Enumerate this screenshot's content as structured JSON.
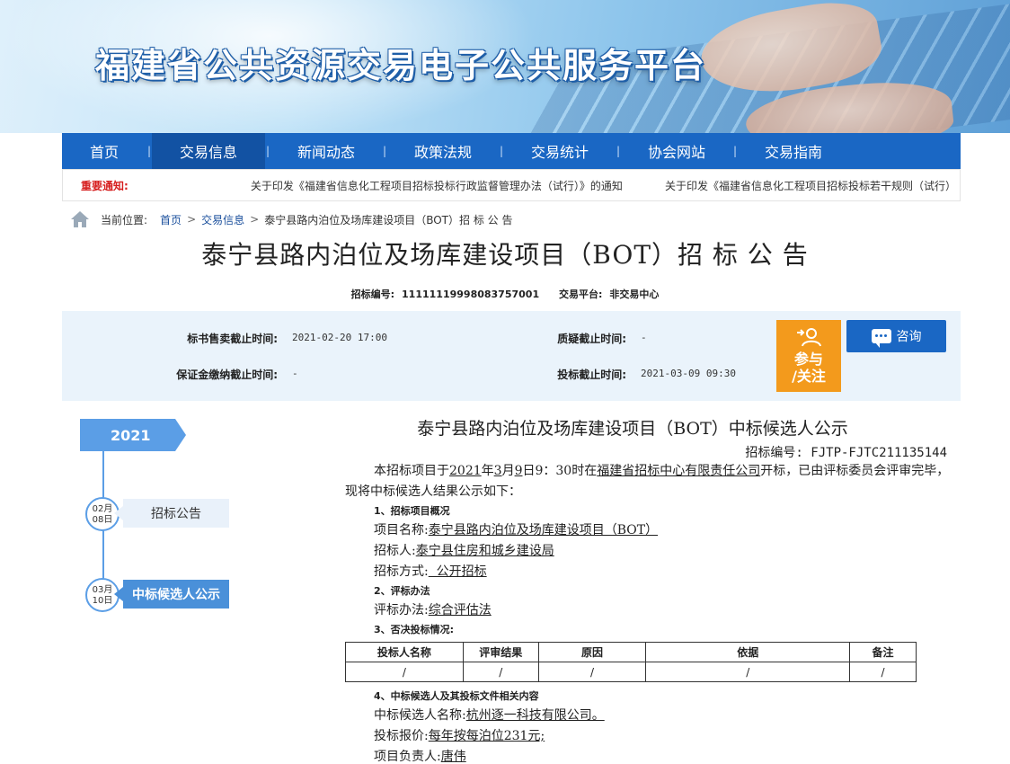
{
  "banner": {
    "title": "福建省公共资源交易电子公共服务平台"
  },
  "nav": {
    "items": [
      "首页",
      "交易信息",
      "新闻动态",
      "政策法规",
      "交易统计",
      "协会网站",
      "交易指南"
    ],
    "separator": "|"
  },
  "notice": {
    "label": "重要通知:",
    "items": [
      "关于印发《福建省信息化工程项目招标投标行政监督管理办法（试行）》的通知",
      "关于印发《福建省信息化工程项目招标投标若干规则（试行）"
    ]
  },
  "breadcrumb": {
    "prefix": "当前位置:",
    "items": [
      "首页",
      "交易信息",
      "泰宁县路内泊位及场库建设项目（BOT）招 标 公 告"
    ]
  },
  "page": {
    "title": "泰宁县路内泊位及场库建设项目（BOT）招 标 公 告",
    "code_label": "招标编号:",
    "code_value": "111111199980837570​01",
    "platform_label": "交易平台:",
    "platform_value": "非交易中心"
  },
  "info": {
    "sale_deadline_label": "标书售卖截止时间:",
    "sale_deadline_value": "2021-02-20 17:00",
    "question_deadline_label": "质疑截止时间:",
    "question_deadline_value": "-",
    "deposit_deadline_label": "保证金缴纳截止时间:",
    "deposit_deadline_value": "-",
    "bid_deadline_label": "投标截止时间:",
    "bid_deadline_value": "2021-03-09 09:30",
    "join_label_1": "参与",
    "join_label_2": "/关注",
    "consult_label": "咨询"
  },
  "timeline": {
    "year": "2021",
    "events": [
      {
        "month": "02月",
        "day": "08日",
        "label": "招标公告"
      },
      {
        "month": "03月",
        "day": "10日",
        "label": "中标候选人公示"
      }
    ]
  },
  "content": {
    "title": "泰宁县路内泊位及场库建设项目（BOT）中标候选人公示",
    "code": "招标编号:  FJTP-FJTC211135144",
    "intro_1": "本招标项目于",
    "intro_year": "2021",
    "intro_2": "年",
    "intro_month": "3",
    "intro_3": "月",
    "intro_day": "9",
    "intro_4": "日9：30时在",
    "intro_org": "福建省招标中心有限责任公司",
    "intro_5": "开标，已由评标委员会评审完毕，现将中标候选人结果公示如下：",
    "sec1": "1、招标项目概况",
    "project_name_label": "项目名称:",
    "project_name_value": "泰宁县路内泊位及场库建设项目（BOT）",
    "tenderer_label": "招标人:",
    "tenderer_value": "泰宁县住房和城乡建设局",
    "method_label": "招标方式:",
    "method_value": "  公开招标",
    "sec2": "2、评标办法",
    "eval_label": "评标办法:",
    "eval_value": "综合评估法",
    "sec3": "3、否决投标情况:",
    "table_headers": [
      "投标人名称",
      "评审结果",
      "原因",
      "依据",
      "备注"
    ],
    "table_row": [
      "/",
      "/",
      "/",
      "/",
      "/"
    ],
    "sec4": "4、中标候选人及其投标文件相关内容",
    "candidate_label": "中标候选人名称:",
    "candidate_value": "杭州逐一科技有限公司。",
    "price_label": "投标报价:",
    "price_value": "每年按每泊位231元;",
    "manager_label": "项目负责人:",
    "manager_value": "唐伟"
  }
}
